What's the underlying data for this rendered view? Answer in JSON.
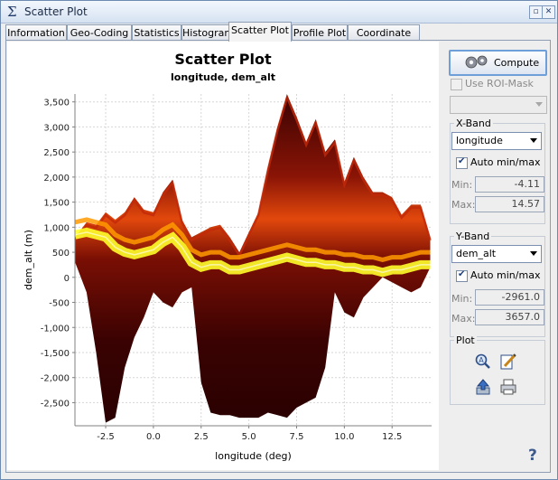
{
  "window": {
    "title": "Scatter Plot"
  },
  "tabs": [
    "Information",
    "Geo-Coding",
    "Statistics",
    "Histogram",
    "Scatter Plot",
    "Profile Plot",
    "Coordinate List"
  ],
  "active_tab": "Scatter Plot",
  "controls": {
    "compute_label": "Compute",
    "use_roi_mask_label": "Use ROI-Mask",
    "use_roi_mask_checked": false,
    "roi_mask_value": "",
    "x_band": {
      "title": "X-Band",
      "band": "longitude",
      "auto_label": "Auto min/max",
      "auto_checked": true,
      "min_label": "Min:",
      "min_value": "-4.11",
      "max_label": "Max:",
      "max_value": "14.57"
    },
    "y_band": {
      "title": "Y-Band",
      "band": "dem_alt",
      "auto_label": "Auto min/max",
      "auto_checked": true,
      "min_label": "Min:",
      "min_value": "-2961.0",
      "max_label": "Max:",
      "max_value": "3657.0"
    },
    "plot_group": {
      "title": "Plot"
    },
    "help_label": "?"
  },
  "icons": [
    "sigma-icon",
    "gear-icon",
    "zoom-icon",
    "edit-icon",
    "export-icon",
    "print-icon",
    "help-icon"
  ],
  "colors": {
    "density_low": "#4a0606",
    "density_mid": "#c2290a",
    "density_high": "#ff9a00",
    "density_peak": "#ffff2a",
    "tab_border": "#8d9db4"
  },
  "chart_data": {
    "type": "scatter",
    "title": "Scatter Plot",
    "subtitle": "longitude, dem_alt",
    "xlabel": "longitude (deg)",
    "ylabel": "dem_alt (m)",
    "xlim": [
      -4.11,
      14.57
    ],
    "ylim": [
      -2961.0,
      3657.0
    ],
    "xticks": [
      -2.5,
      0.0,
      2.5,
      5.0,
      7.5,
      10.0,
      12.5
    ],
    "xtick_labels": [
      "-2.5",
      "0.0",
      "2.5",
      "5.0",
      "7.5",
      "10.0",
      "12.5"
    ],
    "yticks": [
      3500,
      3000,
      2500,
      2000,
      1500,
      1000,
      500,
      0,
      -500,
      -1000,
      -1500,
      -2000,
      -2500
    ],
    "ytick_labels": [
      "3,500",
      "3,000",
      "2,500",
      "2,000",
      "1,500",
      "1,000",
      "500",
      "0",
      "-500",
      "-1,000",
      "-1,500",
      "-2,000",
      "-2,500"
    ],
    "grid": true,
    "density_envelope": {
      "x": [
        -4.1,
        -3.5,
        -3.0,
        -2.5,
        -2.0,
        -1.5,
        -1.0,
        -0.5,
        0.0,
        0.5,
        1.0,
        1.5,
        2.0,
        2.5,
        3.0,
        3.5,
        4.0,
        4.5,
        5.0,
        5.5,
        6.0,
        6.5,
        7.0,
        7.5,
        8.0,
        8.5,
        9.0,
        9.5,
        10.0,
        10.5,
        11.0,
        11.5,
        12.0,
        12.5,
        13.0,
        13.5,
        14.0,
        14.5
      ],
      "upper": [
        800,
        1100,
        1050,
        1300,
        1150,
        1300,
        1600,
        1350,
        1300,
        1700,
        1950,
        1150,
        800,
        900,
        1000,
        1050,
        800,
        500,
        900,
        1300,
        2200,
        3000,
        3650,
        3200,
        2700,
        3150,
        2500,
        2750,
        1900,
        2400,
        2000,
        1700,
        1700,
        1600,
        1250,
        1450,
        1450,
        800
      ],
      "lower": [
        300,
        -300,
        -1500,
        -2900,
        -2800,
        -1800,
        -1200,
        -800,
        -300,
        -500,
        -600,
        -300,
        -200,
        -2100,
        -2700,
        -2750,
        -2750,
        -2800,
        -2800,
        -2800,
        -2700,
        -2750,
        -2800,
        -2600,
        -2500,
        -2400,
        -1800,
        -300,
        -700,
        -800,
        -400,
        -200,
        0,
        -100,
        -200,
        -300,
        -200,
        200
      ],
      "band_center": [
        850,
        900,
        850,
        800,
        600,
        500,
        450,
        500,
        550,
        700,
        800,
        600,
        300,
        200,
        250,
        250,
        150,
        150,
        200,
        250,
        300,
        350,
        400,
        350,
        300,
        300,
        250,
        250,
        200,
        200,
        150,
        150,
        100,
        150,
        150,
        200,
        250,
        250
      ]
    }
  }
}
